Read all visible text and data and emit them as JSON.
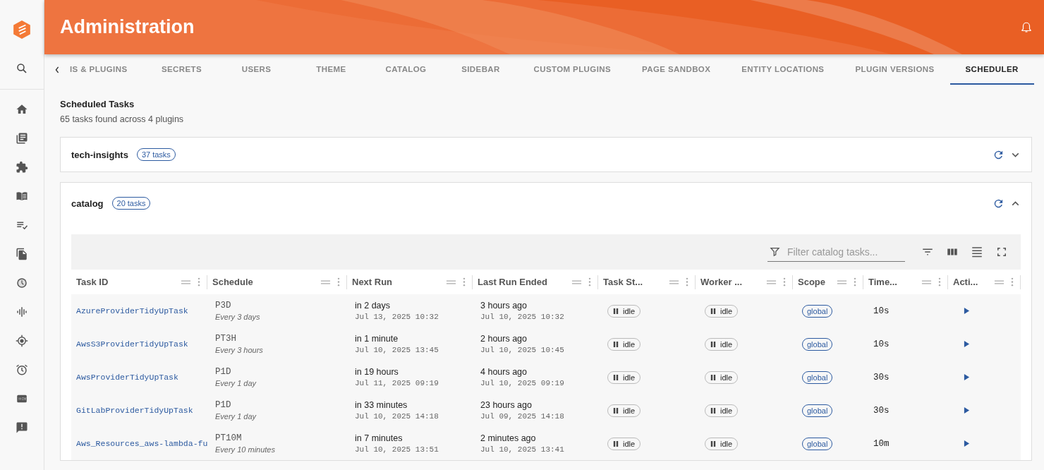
{
  "header": {
    "title": "Administration"
  },
  "tabs": [
    {
      "label": "IS & PLUGINS",
      "selected": false
    },
    {
      "label": "SECRETS",
      "selected": false
    },
    {
      "label": "USERS",
      "selected": false
    },
    {
      "label": "THEME",
      "selected": false
    },
    {
      "label": "CATALOG",
      "selected": false
    },
    {
      "label": "SIDEBAR",
      "selected": false
    },
    {
      "label": "CUSTOM PLUGINS",
      "selected": false
    },
    {
      "label": "PAGE SANDBOX",
      "selected": false
    },
    {
      "label": "ENTITY LOCATIONS",
      "selected": false
    },
    {
      "label": "PLUGIN VERSIONS",
      "selected": false
    },
    {
      "label": "SCHEDULER",
      "selected": true
    }
  ],
  "page": {
    "title": "Scheduled Tasks",
    "subtitle": "65 tasks found across 4 plugins"
  },
  "plugins": [
    {
      "name": "tech-insights",
      "count": "37 tasks",
      "expanded": false
    },
    {
      "name": "catalog",
      "count": "20 tasks",
      "expanded": true
    }
  ],
  "table": {
    "filter_placeholder": "Filter catalog tasks...",
    "columns": [
      "Task ID",
      "Schedule",
      "Next Run",
      "Last Run Ended",
      "Task St...",
      "Worker ...",
      "Scope",
      "Time...",
      "Acti..."
    ],
    "rows": [
      {
        "task_id": "AzureProviderTidyUpTask",
        "schedule": "P3D",
        "schedule_text": "Every 3 days",
        "next_run": "in 2 days",
        "next_run_date": "Jul 13, 2025 10:32",
        "last_run": "3 hours ago",
        "last_run_date": "Jul 10, 2025 10:32",
        "task_status": "idle",
        "worker_status": "idle",
        "scope": "global",
        "timeout": "10s"
      },
      {
        "task_id": "AwsS3ProviderTidyUpTask",
        "schedule": "PT3H",
        "schedule_text": "Every 3 hours",
        "next_run": "in 1 minute",
        "next_run_date": "Jul 10, 2025 13:45",
        "last_run": "2 hours ago",
        "last_run_date": "Jul 10, 2025 10:45",
        "task_status": "idle",
        "worker_status": "idle",
        "scope": "global",
        "timeout": "10s"
      },
      {
        "task_id": "AwsProviderTidyUpTask",
        "schedule": "P1D",
        "schedule_text": "Every 1 day",
        "next_run": "in 19 hours",
        "next_run_date": "Jul 11, 2025 09:19",
        "last_run": "4 hours ago",
        "last_run_date": "Jul 10, 2025 09:19",
        "task_status": "idle",
        "worker_status": "idle",
        "scope": "global",
        "timeout": "30s"
      },
      {
        "task_id": "GitLabProviderTidyUpTask",
        "schedule": "P1D",
        "schedule_text": "Every 1 day",
        "next_run": "in 33 minutes",
        "next_run_date": "Jul 10, 2025 14:18",
        "last_run": "23 hours ago",
        "last_run_date": "Jul 09, 2025 14:18",
        "task_status": "idle",
        "worker_status": "idle",
        "scope": "global",
        "timeout": "30s"
      },
      {
        "task_id": "Aws_Resources_aws-lambda-fu",
        "schedule": "PT10M",
        "schedule_text": "Every 10 minutes",
        "next_run": "in 7 minutes",
        "next_run_date": "Jul 10, 2025 13:51",
        "last_run": "2 minutes ago",
        "last_run_date": "Jul 10, 2025 13:41",
        "task_status": "idle",
        "worker_status": "idle",
        "scope": "global",
        "timeout": "10m"
      }
    ]
  }
}
